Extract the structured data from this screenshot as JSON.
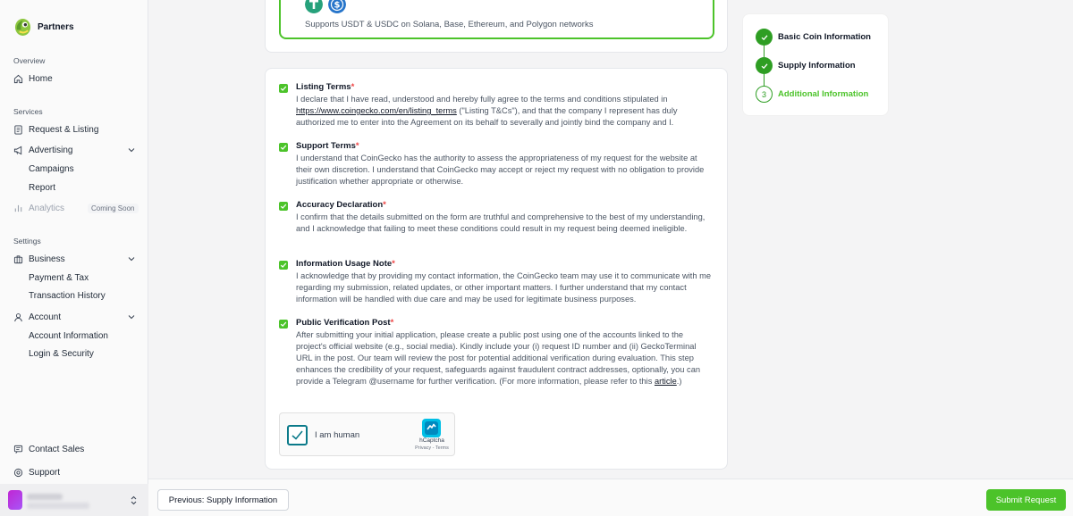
{
  "sidebar": {
    "brand": "Partners",
    "overview_label": "Overview",
    "home": "Home",
    "services_label": "Services",
    "request_listing": "Request & Listing",
    "advertising": "Advertising",
    "campaigns": "Campaigns",
    "report": "Report",
    "analytics": "Analytics",
    "coming_soon": "Coming Soon",
    "settings_label": "Settings",
    "business": "Business",
    "payment_tax": "Payment & Tax",
    "transaction_history": "Transaction History",
    "account": "Account",
    "account_information": "Account Information",
    "login_security": "Login & Security",
    "contact_sales": "Contact Sales",
    "support": "Support"
  },
  "payment_note": "Supports USDT & USDC on Solana, Base, Ethereum, and Polygon networks",
  "terms": [
    {
      "title": "Listing Terms",
      "body_pre": "I declare that I have read, understood and hereby fully agree to the terms and conditions stipulated in ",
      "link": "https://www.coingecko.com/en/listing_terms",
      "body_post": " (\"Listing T&Cs\"), and that the company I represent has duly authorized me to enter into the Agreement on its behalf to severally and jointly bind the company and I."
    },
    {
      "title": "Support Terms",
      "body": "I understand that CoinGecko has the authority to assess the appropriateness of my request for the website at their own discretion. I understand that CoinGecko may accept or reject my request with no obligation to provide justification whether appropriate or otherwise."
    },
    {
      "title": "Accuracy Declaration",
      "body": "I confirm that the details submitted on the form are truthful and comprehensive to the best of my understanding, and I acknowledge that failing to meet these conditions could result in my request being deemed ineligible."
    },
    {
      "title": "Information Usage Note",
      "body": "I acknowledge that by providing my contact information, the CoinGecko team may use it to communicate with me regarding my submission, related updates, or other important matters. I further understand that my contact information will be handled with due care and may be used for legitimate business purposes."
    },
    {
      "title": "Public Verification Post",
      "body_pre": "After submitting your initial application, please create a public post using one of the accounts linked to the project's official website (e.g., social media). Kindly include your (i) request ID number and (ii) GeckoTerminal URL in the post. Our team will review the post for potential additional verification during evaluation. This step enhances the credibility of your request, safeguards against fraudulent contract addresses, optionally, you can provide a Telegram @username for further verification. (For more information, please refer to this ",
      "link": "article",
      "body_post": ".)"
    }
  ],
  "required_mark": "*",
  "captcha": {
    "label": "I am human",
    "brand": "hCaptcha",
    "links": "Privacy - Terms"
  },
  "steps": [
    {
      "label": "Basic Coin Information",
      "status": "done"
    },
    {
      "label": "Supply Information",
      "status": "done"
    },
    {
      "label": "Additional Information",
      "status": "current",
      "number": "3"
    }
  ],
  "footer": {
    "prev_label": "Previous: Supply Information",
    "submit_label": "Submit Request"
  },
  "colors": {
    "accent": "#4cc32a",
    "accent_dark": "#2e9e23",
    "required": "#ef4444"
  }
}
